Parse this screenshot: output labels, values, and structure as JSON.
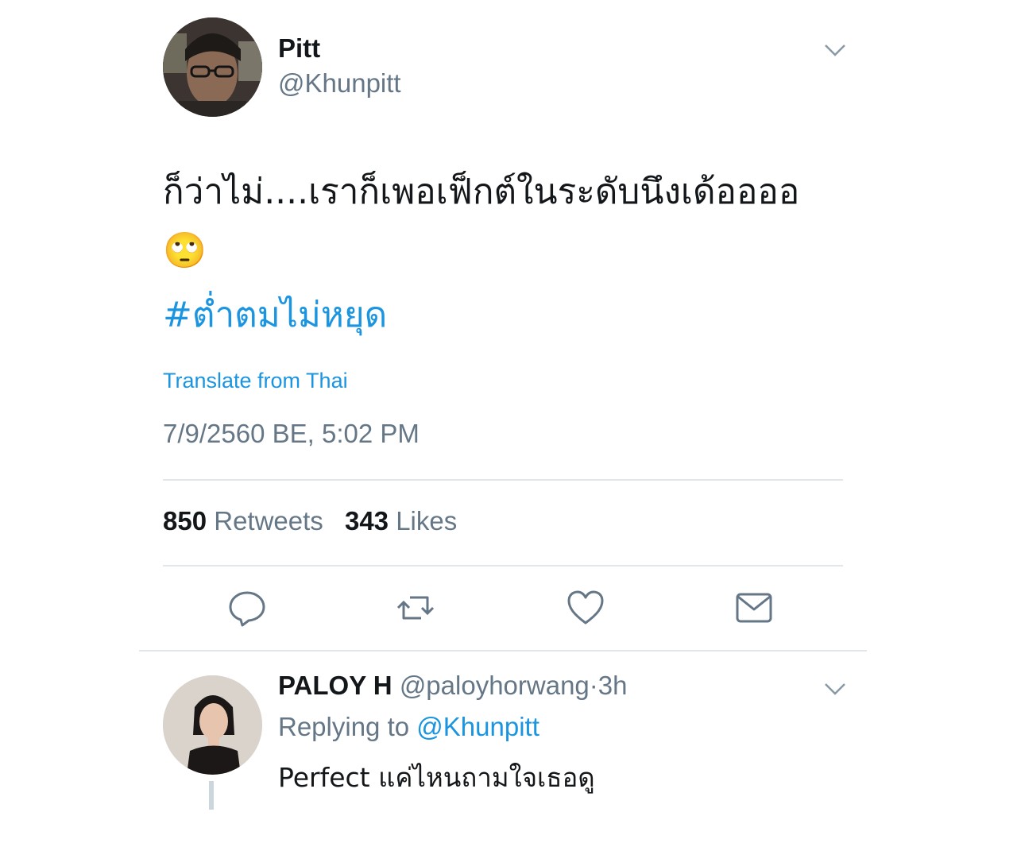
{
  "tweet": {
    "author_name": "Pitt",
    "author_handle": "@Khunpitt",
    "text": "ก็ว่าไม่....เราก็เพอเฟ็กต์ในระดับนึงเด้ออออ 🙄",
    "hashtag": "#ต่ำตมไม่หยุด",
    "translate_label": "Translate from Thai",
    "timestamp": "7/9/2560 BE, 5:02 PM",
    "retweets_count": "850",
    "retweets_label": "Retweets",
    "likes_count": "343",
    "likes_label": "Likes"
  },
  "actions": [
    "reply-icon",
    "retweet-icon",
    "like-icon",
    "direct-message-icon"
  ],
  "reply": {
    "author_name": "PALOY H",
    "author_handle": "@paloyhorwang",
    "separator": "·",
    "time_ago": "3h",
    "replying_prefix": "Replying to",
    "replying_to": "@Khunpitt",
    "text": "Perfect แค่ไหนถามใจเธอดู"
  },
  "colors": {
    "link": "#1b95e0",
    "secondary_text": "#657786",
    "primary_text": "#14171a",
    "divider": "#e1e8ed"
  }
}
